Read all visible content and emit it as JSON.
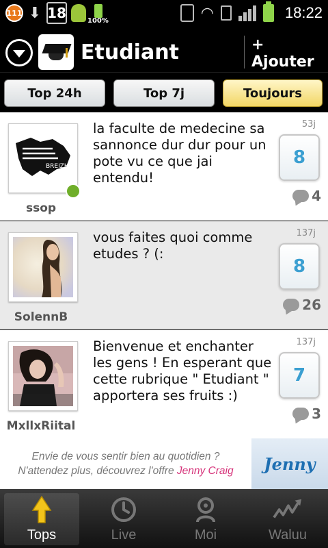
{
  "status_bar": {
    "notif_count": "111",
    "calendar_day": "18",
    "battery_percent": "100%",
    "time": "18:22"
  },
  "header": {
    "title": "Etudiant",
    "add_label": "+ Ajouter"
  },
  "tabs": [
    {
      "label": "Top 24h",
      "active": false
    },
    {
      "label": "Top 7j",
      "active": false
    },
    {
      "label": "Toujours",
      "active": true
    }
  ],
  "posts": [
    {
      "username": "ssop",
      "text": "la faculte de medecine sa sannonce dur dur pour un pote vu ce que jai entendu!",
      "age": "53j",
      "votes": "8",
      "comments": "4",
      "online": true
    },
    {
      "username": "SolennB",
      "text": "vous faites quoi comme etudes ? (:",
      "age": "137j",
      "votes": "8",
      "comments": "26",
      "online": false
    },
    {
      "username": "MxllxRiital",
      "text": "Bienvenue et enchanter les gens ! En esperant que cette rubrique \" Etudiant \" apportera ses fruits :)",
      "age": "137j",
      "votes": "7",
      "comments": "3",
      "online": false
    }
  ],
  "ad": {
    "line1": "Envie de vous sentir bien au quotidien ?",
    "line2_prefix": "N'attendez plus, découvrez l'offre ",
    "line2_highlight": "Jenny Craig",
    "logo_text": "Jenny"
  },
  "bottom_nav": [
    {
      "label": "Tops",
      "icon": "arrow-up-icon",
      "active": true
    },
    {
      "label": "Live",
      "icon": "clock-icon",
      "active": false
    },
    {
      "label": "Moi",
      "icon": "user-icon",
      "active": false
    },
    {
      "label": "Waluu",
      "icon": "waluu-logo-icon",
      "active": false
    }
  ],
  "colors": {
    "accent_vote": "#3b9fd1",
    "active_tab": "#f2d665",
    "online": "#6fae2a",
    "ad_highlight": "#d6337a"
  }
}
